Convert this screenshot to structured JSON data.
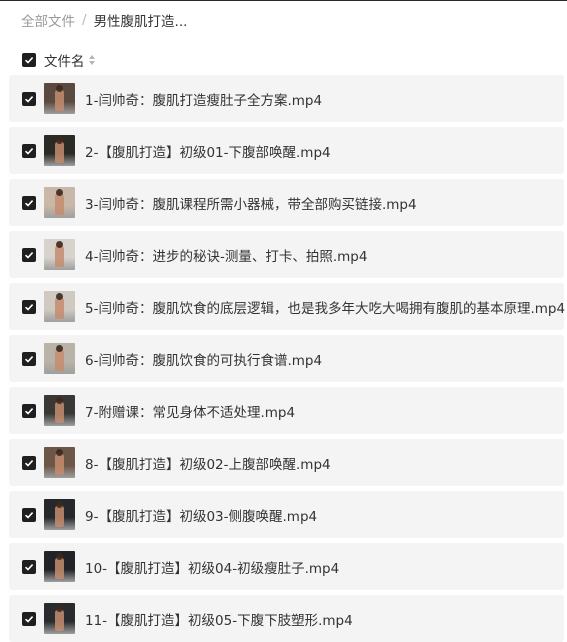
{
  "breadcrumb": {
    "root": "全部文件",
    "separator": "/",
    "current": "男性腹肌打造..."
  },
  "header": {
    "label": "文件名",
    "sort_icon": "sort-icon"
  },
  "files": [
    {
      "name": "1-闫帅奇：腹肌打造瘦肚子全方案.mp4",
      "thumb_bg": "#5a4a3f"
    },
    {
      "name": "2-【腹肌打造】初级01-下腹部唤醒.mp4",
      "thumb_bg": "#2c2a25"
    },
    {
      "name": "3-闫帅奇：腹肌课程所需小器械，带全部购买链接.mp4",
      "thumb_bg": "#c9b8a8"
    },
    {
      "name": "4-闫帅奇：进步的秘诀-测量、打卡、拍照.mp4",
      "thumb_bg": "#d8d2cc"
    },
    {
      "name": "5-闫帅奇：腹肌饮食的底层逻辑，也是我多年大吃大喝拥有腹肌的基本原理.mp4",
      "thumb_bg": "#cfc9c1"
    },
    {
      "name": "6-闫帅奇：腹肌饮食的可执行食谱.mp4",
      "thumb_bg": "#b9b2a6"
    },
    {
      "name": "7-附赠课：常见身体不适处理.mp4",
      "thumb_bg": "#3a3835"
    },
    {
      "name": "8-【腹肌打造】初级02-上腹部唤醒.mp4",
      "thumb_bg": "#6b5648"
    },
    {
      "name": "9-【腹肌打造】初级03-侧腹唤醒.mp4",
      "thumb_bg": "#26282c"
    },
    {
      "name": "10-【腹肌打造】初级04-初级瘦肚子.mp4",
      "thumb_bg": "#222326"
    },
    {
      "name": "11-【腹肌打造】初级05-下腹下肢塑形.mp4",
      "thumb_bg": "#2a2b2f"
    }
  ],
  "colors": {
    "row_bg": "#f4f4f4",
    "checkbox": "#1f1f1f",
    "text": "#333333",
    "muted": "#9a9a9a"
  }
}
